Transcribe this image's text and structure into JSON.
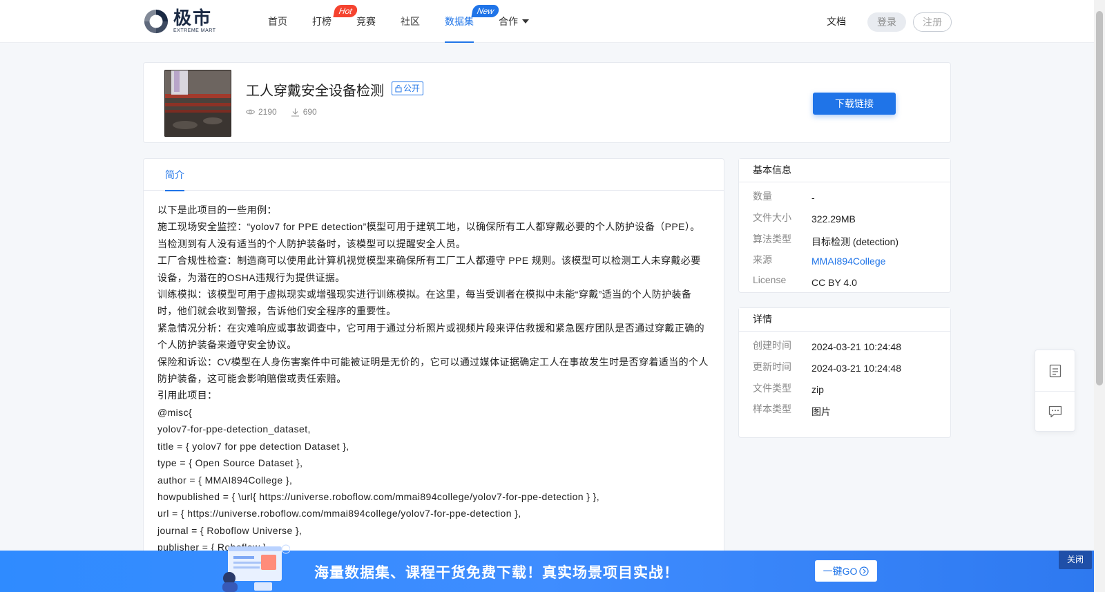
{
  "header": {
    "logo_cn": "极市",
    "logo_en": "EXTREME MART",
    "nav": [
      {
        "label": "首页"
      },
      {
        "label": "打榜",
        "badge": "Hot"
      },
      {
        "label": "竞赛"
      },
      {
        "label": "社区"
      },
      {
        "label": "数据集",
        "badge": "New",
        "active": true
      },
      {
        "label": "合作"
      }
    ],
    "docs": "文档",
    "login": "登录",
    "register": "注册"
  },
  "dataset": {
    "title": "工人穿戴安全设备检测",
    "visibility": "公开",
    "views": "2190",
    "downloads": "690",
    "download_button": "下载链接"
  },
  "tabs": {
    "intro": "简介"
  },
  "description": [
    "以下是此项目的一些用例：",
    "施工现场安全监控：“yolov7 for PPE detection”模型可用于建筑工地，以确保所有工人都穿戴必要的个人防护设备（PPE）。当检测到有人没有适当的个人防护装备时，该模型可以提醒安全人员。",
    "工厂合规性检查：制造商可以使用此计算机视觉模型来确保所有工厂工人都遵守 PPE 规则。该模型可以检测工人未穿戴必要设备，为潜在的OSHA违规行为提供证据。",
    "训练模拟：该模型可用于虚拟现实或增强现实进行训练模拟。在这里，每当受训者在模拟中未能“穿戴”适当的个人防护装备时，他们就会收到警报，告诉他们安全程序的重要性。",
    "紧急情况分析：在灾难响应或事故调查中，它可用于通过分析照片或视频片段来评估救援和紧急医疗团队是否通过穿戴正确的个人防护装备来遵守安全协议。",
    "保险和诉讼：CV模型在人身伤害案件中可能被证明是无价的，它可以通过媒体证据确定工人在事故发生时是否穿着适当的个人防护装备，这可能会影响赔偿或责任索赔。",
    "引用此项目：",
    "@misc{",
    "yolov7-for-ppe-detection_dataset,",
    "title = { yolov7 for ppe detection Dataset },",
    "type = { Open Source Dataset },",
    "author = { MMAI894College },",
    "howpublished = { \\url{ https://universe.roboflow.com/mmai894college/yolov7-for-ppe-detection } },",
    "url = { https://universe.roboflow.com/mmai894college/yolov7-for-ppe-detection },",
    "journal = { Roboflow Universe },",
    "publisher = { Roboflow },"
  ],
  "basic_info": {
    "title": "基本信息",
    "rows": [
      {
        "k": "数量",
        "v": "-"
      },
      {
        "k": "文件大小",
        "v": "322.29MB"
      },
      {
        "k": "算法类型",
        "v": "目标检测 (detection)"
      },
      {
        "k": "来源",
        "v": "MMAI894College"
      },
      {
        "k": "License",
        "v": "CC BY 4.0"
      }
    ]
  },
  "details": {
    "title": "详情",
    "rows": [
      {
        "k": "创建时间",
        "v": "2024-03-21 10:24:48"
      },
      {
        "k": "更新时间",
        "v": "2024-03-21 10:24:48"
      },
      {
        "k": "文件类型",
        "v": "zip"
      },
      {
        "k": "样本类型",
        "v": "图片"
      }
    ]
  },
  "banner": {
    "slogan": "海量数据集、课程干货免费下载！真实场景项目实战！",
    "go": "一键GO",
    "close": "关闭"
  },
  "colors": {
    "accent": "#1f74e8",
    "hot": "#f5432f",
    "banner": "#2f8bff"
  }
}
